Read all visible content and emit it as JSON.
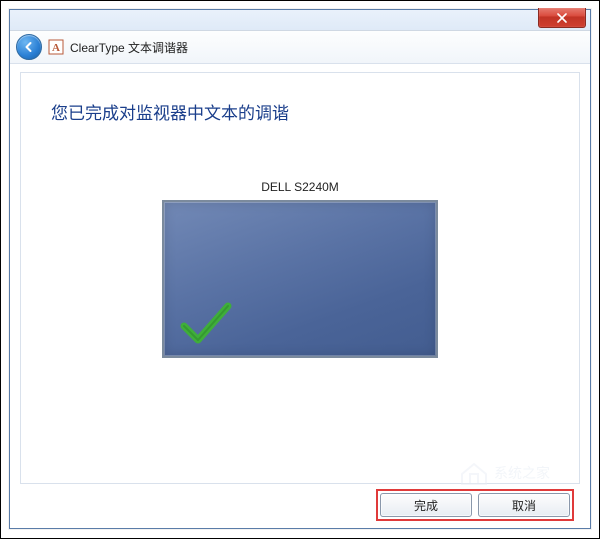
{
  "window": {
    "title": "ClearType 文本调谐器"
  },
  "content": {
    "heading": "您已完成对监视器中文本的调谐",
    "monitor_name": "DELL S2240M"
  },
  "footer": {
    "finish_label": "完成",
    "cancel_label": "取消"
  },
  "watermark_text": "系统之家"
}
